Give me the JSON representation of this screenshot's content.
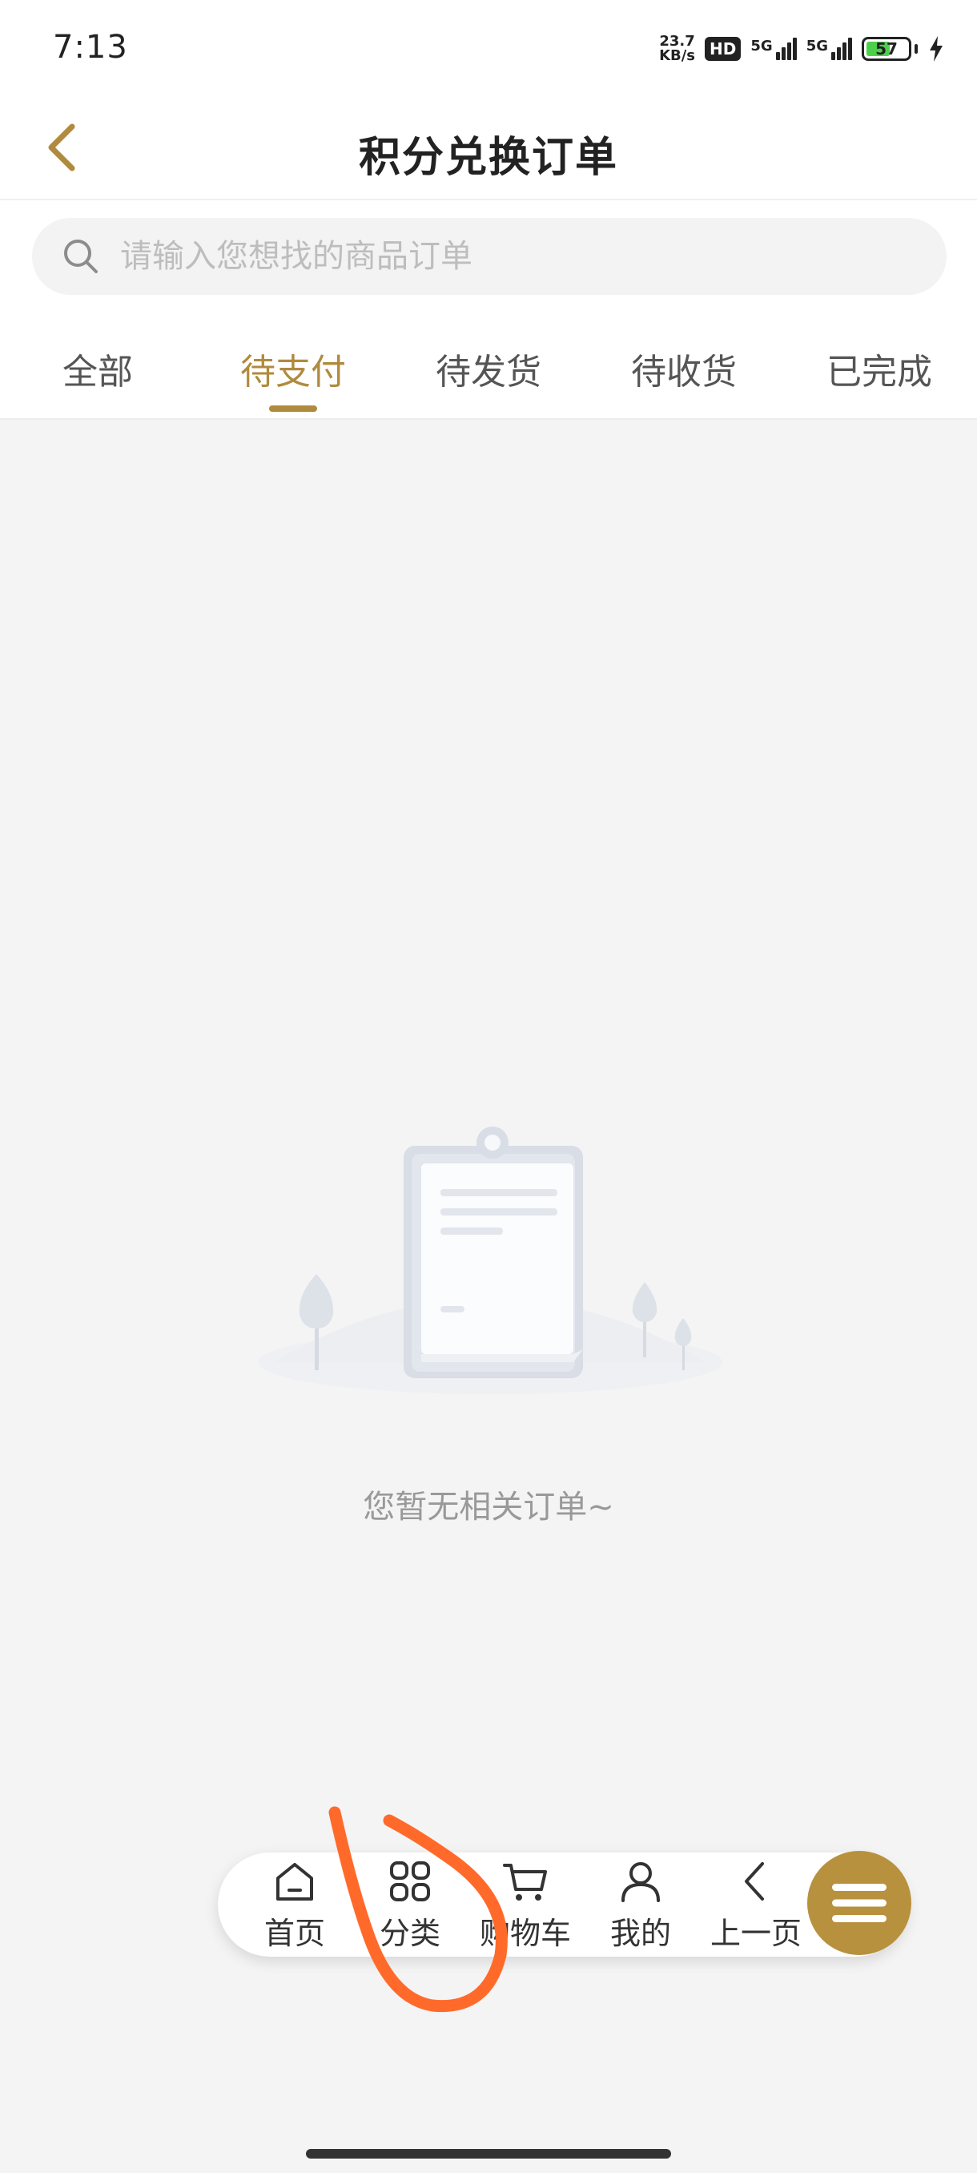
{
  "status_bar": {
    "time": "7:13",
    "net_speed_value": "23.7",
    "net_speed_unit": "KB/s",
    "hd_badge": "HD",
    "sim1_label": "5G",
    "sim2_label": "5G",
    "battery_level": "57",
    "battery_percent": 57
  },
  "header": {
    "title": "积分兑换订单",
    "back_icon": "chevron-left-icon"
  },
  "search": {
    "placeholder": "请输入您想找的商品订单",
    "value": "",
    "icon": "search-icon"
  },
  "tabs": [
    {
      "label": "全部",
      "active": false
    },
    {
      "label": "待支付",
      "active": true
    },
    {
      "label": "待发货",
      "active": false
    },
    {
      "label": "待收货",
      "active": false
    },
    {
      "label": "已完成",
      "active": false
    }
  ],
  "empty_state": {
    "message": "您暂无相关订单~",
    "icon": "clipboard-empty-illustration"
  },
  "bottom_nav": {
    "items": [
      {
        "label": "首页",
        "icon": "home-icon"
      },
      {
        "label": "分类",
        "icon": "grid-icon"
      },
      {
        "label": "购物车",
        "icon": "cart-icon"
      },
      {
        "label": "我的",
        "icon": "user-icon"
      },
      {
        "label": "上一页",
        "icon": "chevron-left-icon"
      }
    ],
    "menu_icon": "menu-icon"
  },
  "colors": {
    "accent": "#b08b3e",
    "fab": "#b8913e",
    "background": "#f4f4f4",
    "annotation": "#ff6a2b"
  }
}
